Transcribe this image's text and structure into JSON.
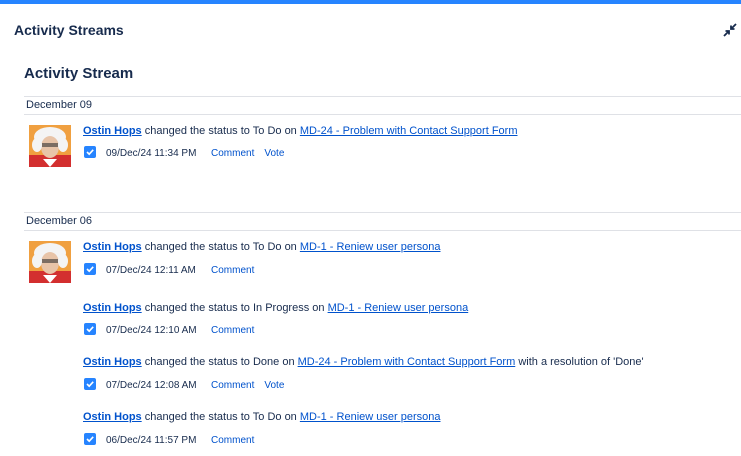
{
  "gadget": {
    "title": "Activity Streams"
  },
  "stream": {
    "title": "Activity Stream"
  },
  "days": [
    {
      "label": "December 09"
    },
    {
      "label": "December 06"
    }
  ],
  "entries": [
    {
      "user": "Ostin Hops",
      "text": " changed the status to To Do on ",
      "issue": "MD-24 - Problem with Contact Support Form",
      "suffix": "",
      "timestamp": "09/Dec/24 11:34 PM",
      "comment": "Comment",
      "vote": "Vote"
    },
    {
      "user": "Ostin Hops",
      "text": " changed the status to To Do on ",
      "issue": "MD-1 - Reniew user persona",
      "suffix": "",
      "timestamp": "07/Dec/24 12:11 AM",
      "comment": "Comment"
    },
    {
      "user": "Ostin Hops",
      "text": " changed the status to In Progress on ",
      "issue": "MD-1 - Reniew user persona",
      "suffix": "",
      "timestamp": "07/Dec/24 12:10 AM",
      "comment": "Comment"
    },
    {
      "user": "Ostin Hops",
      "text": " changed the status to Done on ",
      "issue": "MD-24 - Problem with Contact Support Form",
      "suffix": " with a resolution of 'Done'",
      "timestamp": "07/Dec/24 12:08 AM",
      "comment": "Comment",
      "vote": "Vote"
    },
    {
      "user": "Ostin Hops",
      "text": " changed the status to To Do on ",
      "issue": "MD-1 - Reniew user persona",
      "suffix": "",
      "timestamp": "06/Dec/24 11:57 PM",
      "comment": "Comment"
    }
  ],
  "colors": {
    "accent": "#2684ff",
    "link": "#0052cc",
    "text": "#172b4d",
    "divider": "#dfe1e6"
  },
  "icons": {
    "minimize": "minimize-arrows-icon",
    "status": "checkbox-checked-icon"
  }
}
